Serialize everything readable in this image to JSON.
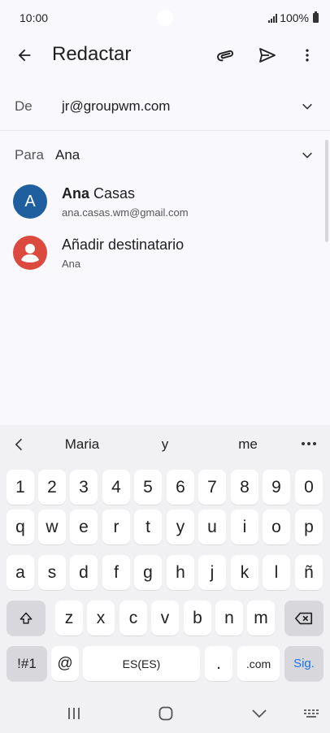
{
  "status": {
    "time": "10:00",
    "battery": "100%"
  },
  "app_bar": {
    "title": "Redactar"
  },
  "from": {
    "label": "De",
    "value": "jr@groupwm.com"
  },
  "to": {
    "label": "Para",
    "value": "Ana"
  },
  "suggestions": [
    {
      "avatar_letter": "A",
      "name_bold": "Ana",
      "name_rest": " Casas",
      "sub": "ana.casas.wm@gmail.com",
      "avatar_color": "#1f5fa0"
    },
    {
      "avatar_letter": "",
      "name_bold": "",
      "name_rest": "Añadir destinatario",
      "sub": "Ana",
      "avatar_color": "#dc4a3f"
    }
  ],
  "predictions": [
    "Maria",
    "y",
    "me"
  ],
  "keys": {
    "row1": [
      "1",
      "2",
      "3",
      "4",
      "5",
      "6",
      "7",
      "8",
      "9",
      "0"
    ],
    "row2": [
      "q",
      "w",
      "e",
      "r",
      "t",
      "y",
      "u",
      "i",
      "o",
      "p"
    ],
    "row3": [
      "a",
      "s",
      "d",
      "f",
      "g",
      "h",
      "j",
      "k",
      "l",
      "ñ"
    ],
    "row4": [
      "z",
      "x",
      "c",
      "v",
      "b",
      "n",
      "m"
    ],
    "symbols": "!#1",
    "at": "@",
    "space": "ES(ES)",
    "period": ".",
    "dotcom": ".com",
    "next": "Sig."
  },
  "colors": {
    "accent": "#1a73e8",
    "background": "#f9f9fd",
    "keyboard": "#f1f1f3"
  }
}
